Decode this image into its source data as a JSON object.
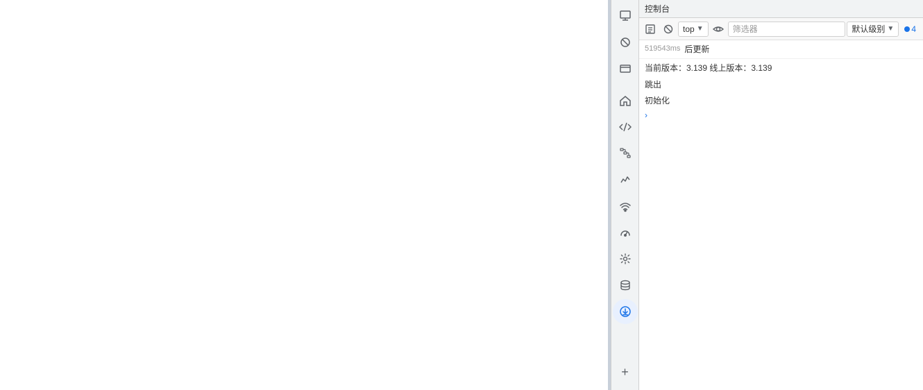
{
  "devtools": {
    "title": "控制台",
    "toolbar": {
      "top_label": "top",
      "filter_placeholder": "筛选器",
      "level_label": "默认级别",
      "badge_count": "4"
    },
    "console": {
      "entries": [
        {
          "timestamp": "519543ms",
          "text": "后更新"
        },
        {
          "version_line": "当前版本：3.139 线上版本：3.139"
        },
        {
          "plain_line": "跳出"
        },
        {
          "plain_line": "初始化"
        }
      ]
    },
    "sidebar": {
      "icons": [
        {
          "name": "inspect-icon",
          "title": "元素"
        },
        {
          "name": "cursor-icon",
          "title": "选择"
        },
        {
          "name": "frame-icon",
          "title": "框架"
        },
        {
          "name": "home-icon",
          "title": "主页"
        },
        {
          "name": "code-icon",
          "title": "源代码"
        },
        {
          "name": "network-icon",
          "title": "网络"
        },
        {
          "name": "performance-icon",
          "title": "性能"
        },
        {
          "name": "wifi-icon",
          "title": "无线"
        },
        {
          "name": "gauge-icon",
          "title": "测量"
        },
        {
          "name": "settings-icon",
          "title": "设置"
        },
        {
          "name": "database-icon",
          "title": "存储"
        },
        {
          "name": "download-icon",
          "title": "下载"
        }
      ],
      "add_label": "+"
    }
  }
}
